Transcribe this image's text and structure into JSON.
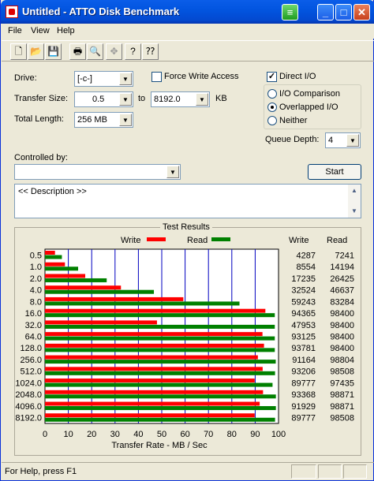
{
  "window": {
    "title": "Untitled - ATTO Disk Benchmark"
  },
  "menu": [
    "File",
    "View",
    "Help"
  ],
  "toolbar_icons": [
    "new-file-icon",
    "open-folder-icon",
    "save-icon",
    "print-icon",
    "print-preview-icon",
    "move-icon",
    "help-icon",
    "context-help-icon"
  ],
  "form": {
    "drive_label": "Drive:",
    "drive_value": "[-c-]",
    "force_write_label": "Force Write Access",
    "force_write_checked": false,
    "direct_io_label": "Direct I/O",
    "direct_io_checked": true,
    "transfer_size_label": "Transfer Size:",
    "transfer_from": "0.5",
    "to_label": "to",
    "transfer_to": "8192.0",
    "kb_label": "KB",
    "total_length_label": "Total Length:",
    "total_length_value": "256 MB",
    "io_comparison_label": "I/O Comparison",
    "overlapped_io_label": "Overlapped I/O",
    "neither_label": "Neither",
    "io_mode_selected": "Overlapped I/O",
    "queue_depth_label": "Queue Depth:",
    "queue_depth_value": "4",
    "controlled_by_label": "Controlled by:",
    "controlled_by_value": "",
    "start_label": "Start",
    "description": "<< Description >>"
  },
  "results": {
    "title": "Test Results",
    "legend_write": "Write",
    "legend_read": "Read",
    "col_write": "Write",
    "col_read": "Read",
    "write_color": "#ff0000",
    "read_color": "#008000",
    "grid_color": "#0000c0"
  },
  "chart_data": {
    "type": "bar",
    "orientation": "horizontal",
    "categories": [
      "0.5",
      "1.0",
      "2.0",
      "4.0",
      "8.0",
      "16.0",
      "32.0",
      "64.0",
      "128.0",
      "256.0",
      "512.0",
      "1024.0",
      "2048.0",
      "4096.0",
      "8192.0"
    ],
    "series": [
      {
        "name": "Write",
        "values": [
          4287,
          8554,
          17235,
          32524,
          59243,
          94365,
          47953,
          93125,
          93781,
          91164,
          93206,
          89777,
          93368,
          91929,
          89777
        ]
      },
      {
        "name": "Read",
        "values": [
          7241,
          14194,
          26425,
          46637,
          83284,
          98400,
          98400,
          98400,
          98400,
          98804,
          98508,
          97435,
          98871,
          98871,
          98508
        ]
      }
    ],
    "xlabel": "Transfer Rate - MB / Sec",
    "xlim": [
      0,
      100
    ],
    "xticks": [
      0,
      10,
      20,
      30,
      40,
      50,
      60,
      70,
      80,
      90,
      100
    ],
    "grid": true
  },
  "status": {
    "text": "For Help, press F1"
  }
}
